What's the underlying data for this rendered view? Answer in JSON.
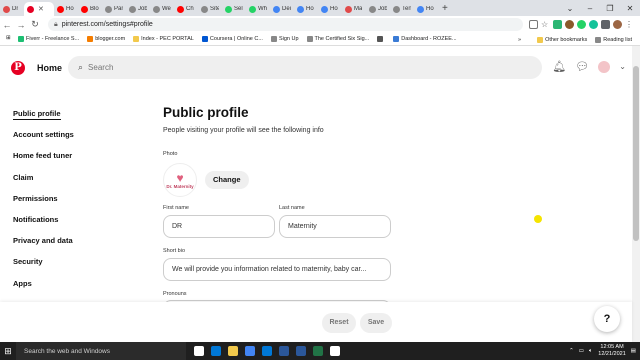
{
  "browser": {
    "tabs": [
      {
        "label": "Dr",
        "color": "#e04a4a"
      },
      {
        "label": "",
        "color": "#e60023",
        "active": true
      },
      {
        "label": "Ho",
        "color": "#ff0000"
      },
      {
        "label": "Blo",
        "color": "#ff0000"
      },
      {
        "label": "Pan",
        "color": "#888888"
      },
      {
        "label": "Job",
        "color": "#888888"
      },
      {
        "label": "We",
        "color": "#888888"
      },
      {
        "label": "Ch",
        "color": "#ff0000"
      },
      {
        "label": "Site",
        "color": "#888888"
      },
      {
        "label": "Sel",
        "color": "#25d366"
      },
      {
        "label": "Wh",
        "color": "#25d366"
      },
      {
        "label": "Dei",
        "color": "#4285f4"
      },
      {
        "label": "Ho",
        "color": "#4285f4"
      },
      {
        "label": "Ho",
        "color": "#4285f4"
      },
      {
        "label": "Ma",
        "color": "#e04a4a"
      },
      {
        "label": "Job",
        "color": "#888888"
      },
      {
        "label": "Ten",
        "color": "#888888"
      },
      {
        "label": "Ho",
        "color": "#4285f4"
      }
    ],
    "new_tab": "+",
    "url": "pinterest.com/settings#profile",
    "bookmarks": [
      {
        "label": "Fiverr - Freelance S...",
        "color": "#1dbf73"
      },
      {
        "label": "blogger.com",
        "color": "#f57d00"
      },
      {
        "label": "Index - PEC PORTAL",
        "color": "#f2c94c"
      },
      {
        "label": "Coursera | Online C...",
        "color": "#0056d2"
      },
      {
        "label": "Sign Up",
        "color": "#888888"
      },
      {
        "label": "The Certified Six Sig...",
        "color": "#888888"
      },
      {
        "label": "",
        "color": "#555555"
      },
      {
        "label": "Dashboard - ROZEE...",
        "color": "#3a7bd5"
      }
    ],
    "other_bookmarks": "Other bookmarks",
    "reading_list": "Reading list"
  },
  "header": {
    "home": "Home",
    "search_placeholder": "Search"
  },
  "sidebar": {
    "items": [
      {
        "label": "Public profile",
        "active": true
      },
      {
        "label": "Account settings"
      },
      {
        "label": "Home feed tuner"
      },
      {
        "label": "Claim"
      },
      {
        "label": "Permissions"
      },
      {
        "label": "Notifications"
      },
      {
        "label": "Privacy and data"
      },
      {
        "label": "Security"
      },
      {
        "label": "Apps"
      }
    ]
  },
  "main": {
    "title": "Public profile",
    "subtitle": "People visiting your profile will see the following info",
    "photo_label": "Photo",
    "avatar_text": "Dr. Maternity",
    "change_button": "Change",
    "first_name_label": "First name",
    "first_name_value": "DR",
    "last_name_label": "Last name",
    "last_name_value": "Maternity",
    "short_bio_label": "Short bio",
    "short_bio_value": "We will provide you information related to maternity, baby car...",
    "pronouns_label": "Pronouns"
  },
  "footer": {
    "reset": "Reset",
    "save": "Save",
    "help": "?"
  },
  "taskbar": {
    "search_placeholder": "Search the web and Windows",
    "time": "12:05 AM",
    "date": "12/21/2021",
    "app_colors": [
      "#ffffff",
      "#0078d7",
      "#f2c94c",
      "#4285f4",
      "#0078d7",
      "#2b579a",
      "#2b579a",
      "#217346",
      "#ffffff"
    ]
  }
}
